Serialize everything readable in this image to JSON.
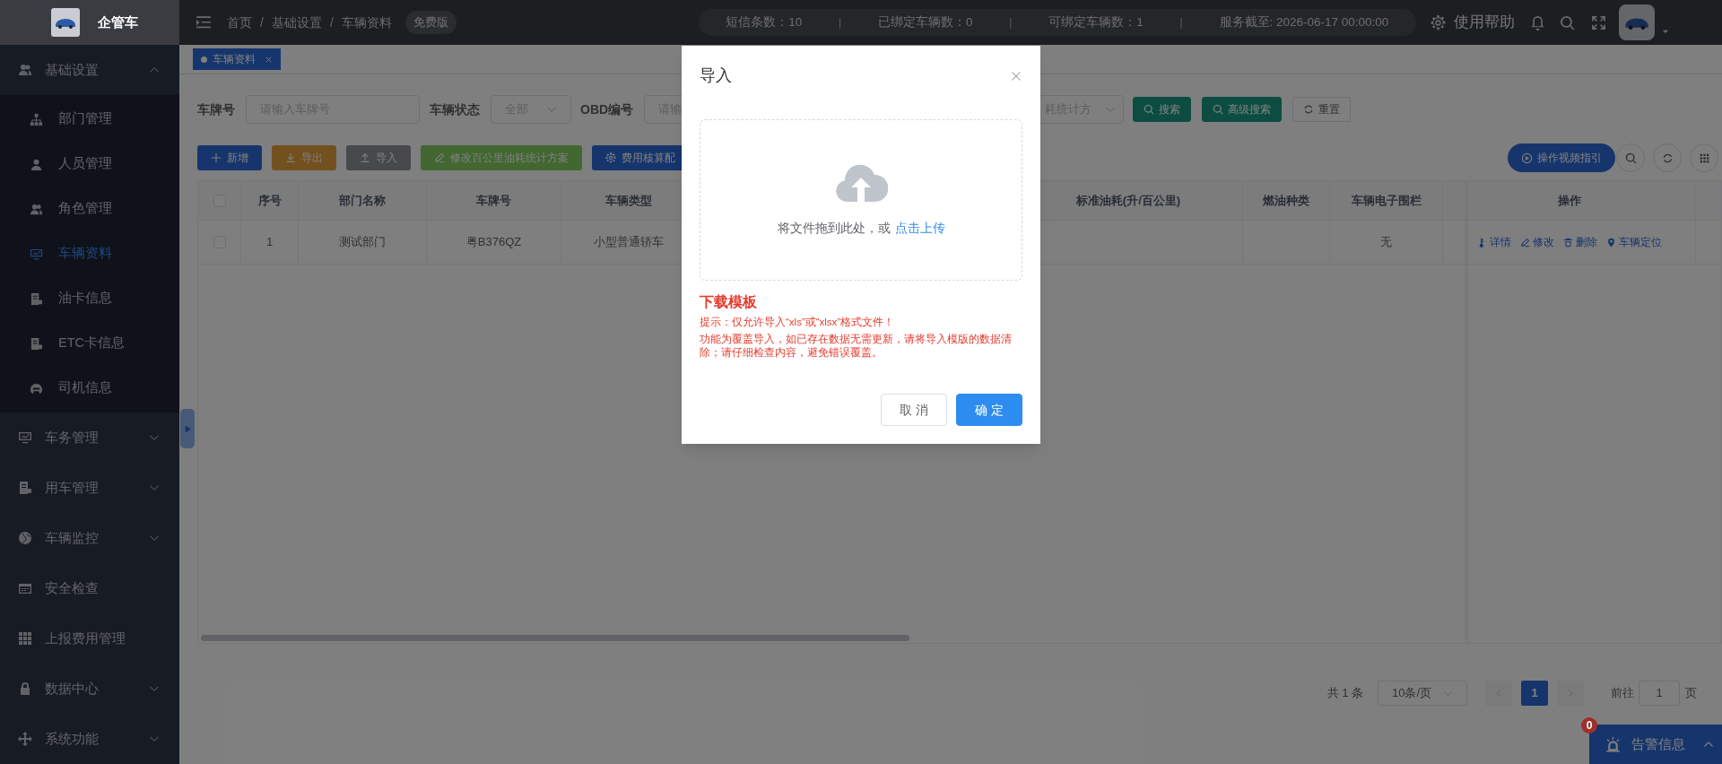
{
  "top_bar": {
    "logo_text": "企管车",
    "breadcrumb": [
      {
        "kind": "item",
        "text": "首页"
      },
      {
        "kind": "separator",
        "text": "/"
      },
      {
        "kind": "item",
        "text": "基础设置"
      },
      {
        "kind": "separator",
        "text": "/"
      },
      {
        "kind": "item",
        "text": "车辆资料"
      }
    ],
    "edition": "免费版",
    "stats": [
      {
        "kind": "item",
        "text": "短信条数：10"
      },
      {
        "kind": "separator",
        "text": "|"
      },
      {
        "kind": "item",
        "text": "已绑定车辆数：0"
      },
      {
        "kind": "separator",
        "text": "|"
      },
      {
        "kind": "item",
        "text": "可绑定车辆数：1"
      },
      {
        "kind": "separator",
        "text": "|"
      },
      {
        "kind": "item",
        "text": "服务截至: 2026-06-17 00:00:00"
      }
    ],
    "help": "使用帮助"
  },
  "tabs": [
    {
      "label": "车辆资料",
      "selected": true
    }
  ],
  "sidebar": {
    "items": [
      {
        "label": "基础设置",
        "kind": "group",
        "expanded": true,
        "children": [
          {
            "label": "部门管理",
            "selected": false
          },
          {
            "label": "人员管理",
            "selected": false
          },
          {
            "label": "角色管理",
            "selected": false
          },
          {
            "label": "车辆资料",
            "selected": true
          },
          {
            "label": "油卡信息",
            "selected": false
          },
          {
            "label": "ETC卡信息",
            "selected": false
          },
          {
            "label": "司机信息",
            "selected": false
          }
        ]
      },
      {
        "label": "车务管理",
        "kind": "group",
        "expanded": false
      },
      {
        "label": "用车管理",
        "kind": "group",
        "expanded": false
      },
      {
        "label": "车辆监控",
        "kind": "group",
        "expanded": false
      },
      {
        "label": "安全检查",
        "kind": "link"
      },
      {
        "label": "上报费用管理",
        "kind": "link"
      },
      {
        "label": "数据中心",
        "kind": "group",
        "expanded": false
      },
      {
        "label": "系统功能",
        "kind": "group",
        "expanded": false
      }
    ]
  },
  "filters": {
    "plate_label": "车牌号",
    "plate_placeholder": "请输入车牌号",
    "status_label": "车辆状态",
    "status_value": "全部",
    "obd_label": "OBD编号",
    "obd_placeholder": "请输",
    "scheme_value": "耗统计方"
  },
  "search_buttons": [
    {
      "label": "搜索",
      "kind": "search"
    },
    {
      "label": "高级搜索",
      "kind": "advanced"
    },
    {
      "label": "重置",
      "kind": "reset"
    }
  ],
  "actions": [
    {
      "label": "新增",
      "kind": "add"
    },
    {
      "label": "导出",
      "kind": "export"
    },
    {
      "label": "导入",
      "kind": "import"
    },
    {
      "label": "修改百公里油耗统计方案",
      "kind": "edit"
    },
    {
      "label": "费用核算配",
      "kind": "config"
    }
  ],
  "guide_button": "操作视频指引",
  "table": {
    "select_all_checked": false,
    "columns": [
      "序号",
      "部门名称",
      "车牌号",
      "车辆类型",
      "",
      "标准油耗(升/百公里)",
      "燃油种类",
      "车辆电子围栏",
      "操作"
    ],
    "rows": [
      {
        "checked": false,
        "cells": [
          "1",
          "测试部门",
          "粤B376QZ",
          "小型普通轿车",
          "",
          "",
          "",
          "无"
        ],
        "actions": [
          "详情",
          "修改",
          "删除",
          "车辆定位"
        ]
      }
    ]
  },
  "pagination": {
    "total": "共 1 条",
    "page_size": "10条/页",
    "pages": [
      {
        "label": "1",
        "selected": true
      }
    ],
    "goto_label": "前往",
    "goto_value": "1",
    "goto_suffix": "页"
  },
  "alarm": {
    "label": "告警信息",
    "count": "0"
  },
  "dialog": {
    "title": "导入",
    "drop_hint": "将文件拖到此处，或",
    "upload_link": "点击上传",
    "template_link": "下载模板",
    "tips": [
      "提示：仅允许导入“xls”或“xlsx”格式文件！",
      "功能为覆盖导入，如已存在数据无需更新，请将导入模版的数据清除；请仔细检查内容，避免错误覆盖。"
    ],
    "buttons": [
      {
        "label": "取 消",
        "kind": "cancel"
      },
      {
        "label": "确 定",
        "kind": "confirm"
      }
    ]
  }
}
